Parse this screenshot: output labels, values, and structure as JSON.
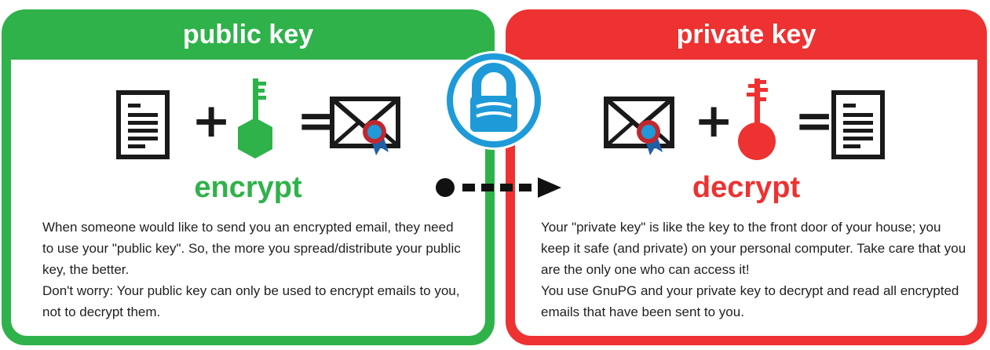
{
  "public": {
    "title": "public key",
    "action": "encrypt",
    "paragraph_1": "When someone would like to send you an encrypted email, they need to use your \"public key\". So, the more you spread/distribute your public key, the better.",
    "paragraph_2": "Don't worry: Your public key can only be used to encrypt emails to you, not to decrypt them.",
    "plus": "+",
    "equals": "="
  },
  "private": {
    "title": "private key",
    "action": "decrypt",
    "paragraph_1": "Your \"private key\" is like the key to the front door of your house; you keep it safe (and private) on your personal computer. Take care that you are the only one who can access it!",
    "paragraph_2": "You use GnuPG and your private key to decrypt and read all encrypted emails that have been sent to you.",
    "plus": "+",
    "equals": "="
  },
  "colors": {
    "public_green": "#2fb24a",
    "private_red": "#ee3131",
    "logo_blue": "#1e9ad8"
  },
  "icons": [
    "document-icon",
    "key-icon",
    "signed-envelope-icon",
    "gnupg-lock-logo",
    "arrow-icon"
  ]
}
